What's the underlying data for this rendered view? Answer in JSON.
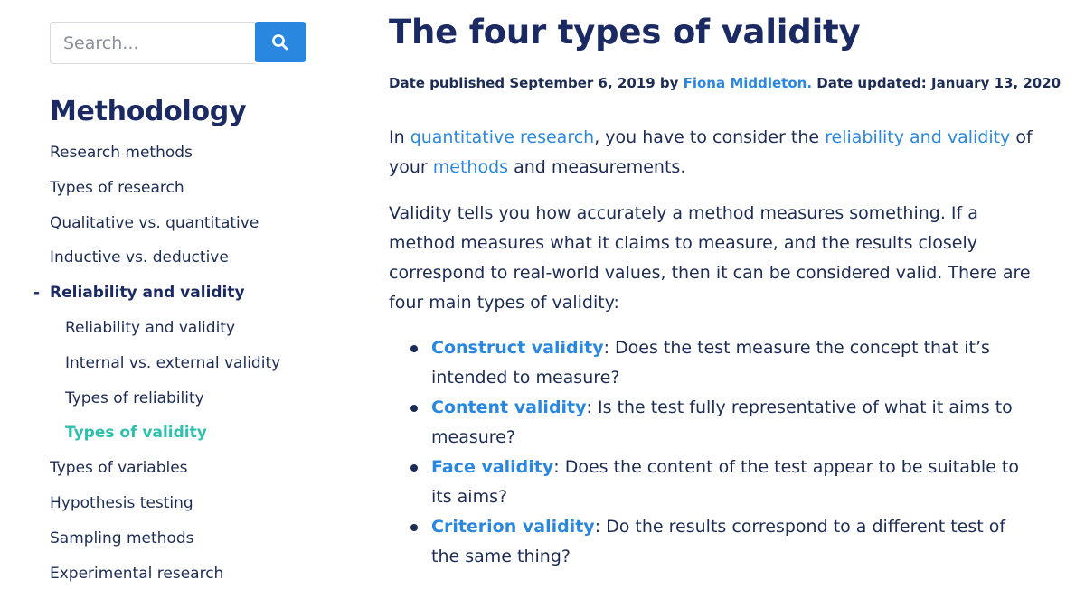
{
  "search": {
    "placeholder": "Search..."
  },
  "sidebar": {
    "heading": "Methodology",
    "items": [
      {
        "label": "Research methods"
      },
      {
        "label": "Types of research"
      },
      {
        "label": "Qualitative vs. quantitative"
      },
      {
        "label": "Inductive vs. deductive"
      },
      {
        "label": "Reliability and validity",
        "marker": "-"
      },
      {
        "label": "Reliability and validity"
      },
      {
        "label": "Internal vs. external validity"
      },
      {
        "label": "Types of reliability"
      },
      {
        "label": "Types of validity"
      },
      {
        "label": "Types of variables"
      },
      {
        "label": "Hypothesis testing"
      },
      {
        "label": "Sampling methods"
      },
      {
        "label": "Experimental research"
      }
    ]
  },
  "article": {
    "title": "The four types of validity",
    "meta": {
      "published_prefix": "Date published September 6, 2019 by ",
      "author": "Fiona Middleton.",
      "updated": " Date updated: January 13, 2020"
    },
    "p1": {
      "t1": "In ",
      "link1": "quantitative research",
      "t2": ", you have to consider the ",
      "link2": "reliability and validity",
      "t3": " of your ",
      "link3": "methods",
      "t4": " and measurements."
    },
    "p2": "Validity tells you how accurately a method measures something. If a method measures what it claims to measure, and the results closely correspond to real-world values, then it can be considered valid. There are four main types of validity:",
    "bullets": [
      {
        "term": "Construct validity",
        "text": ": Does the test measure the concept that it’s intended to measure?"
      },
      {
        "term": "Content validity",
        "text": ": Is the test fully representative of what it aims to measure?"
      },
      {
        "term": "Face validity",
        "text": ": Does the content of the test appear to be suitable to its aims?"
      },
      {
        "term": "Criterion validity",
        "text": ": Do the results correspond to a different test of the same thing?"
      }
    ]
  },
  "colors": {
    "navy": "#1b2a63",
    "text": "#1d2c55",
    "link": "#2a87e0",
    "active": "#2cc0ad",
    "search_button": "#2a87e0"
  }
}
